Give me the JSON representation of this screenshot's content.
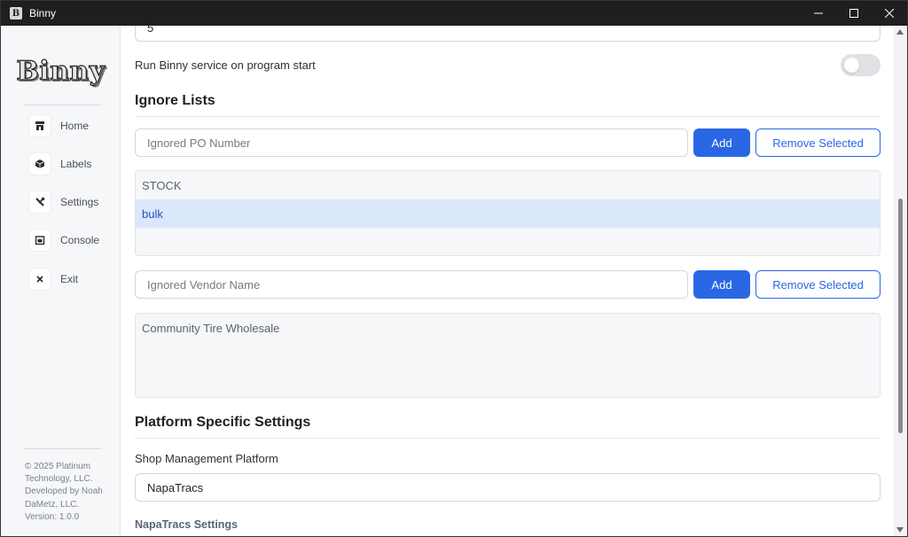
{
  "window": {
    "title": "Binny",
    "app_icon_letter": "B"
  },
  "sidebar": {
    "logo": "Binny",
    "items": [
      {
        "label": "Home",
        "icon": "store-icon"
      },
      {
        "label": "Labels",
        "icon": "box-icon"
      },
      {
        "label": "Settings",
        "icon": "tools-icon"
      },
      {
        "label": "Console",
        "icon": "console-icon"
      },
      {
        "label": "Exit",
        "icon": "x-icon"
      }
    ],
    "footer": {
      "copyright": "© 2025 Platinum Technology, LLC.",
      "developer": "Developed by Noah DaMetz, LLC.",
      "version": "Version: 1.0.0"
    }
  },
  "main": {
    "top_field_value": "5",
    "run_service_label": "Run Binny service on program start",
    "run_service_enabled": false,
    "ignore_lists": {
      "title": "Ignore Lists",
      "po": {
        "placeholder": "Ignored PO Number",
        "add_label": "Add",
        "remove_label": "Remove Selected",
        "items": [
          "STOCK",
          "bulk"
        ],
        "selected_index": 1
      },
      "vendor": {
        "placeholder": "Ignored Vendor Name",
        "add_label": "Add",
        "remove_label": "Remove Selected",
        "items": [
          "Community Tire Wholesale"
        ]
      }
    },
    "platform": {
      "title": "Platform Specific Settings",
      "shop_platform_label": "Shop Management Platform",
      "shop_platform_value": "NapaTracs",
      "subheading": "NapaTracs Settings"
    }
  },
  "colors": {
    "accent": "#2a67e4",
    "selected_row_bg": "#dbe7fb",
    "sidebar_bg": "#f6f7f9"
  }
}
